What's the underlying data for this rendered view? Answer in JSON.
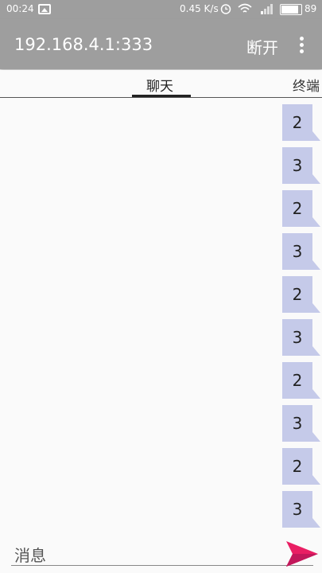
{
  "status_bar": {
    "time": "00:24",
    "speed": "0.45 K/s",
    "battery": "89"
  },
  "app_bar": {
    "title": "192.168.4.1:333",
    "disconnect_label": "断开"
  },
  "tabs": [
    {
      "label": "聊天",
      "selected": true
    },
    {
      "label": "终端",
      "selected": false
    }
  ],
  "messages": [
    "2",
    "3",
    "2",
    "3",
    "2",
    "3",
    "2",
    "3",
    "2",
    "3"
  ],
  "input": {
    "placeholder": "消息"
  },
  "colors": {
    "toolbar": "#9e9e9e",
    "bubble": "#c5cae9",
    "send_accent": "#e91e63"
  }
}
